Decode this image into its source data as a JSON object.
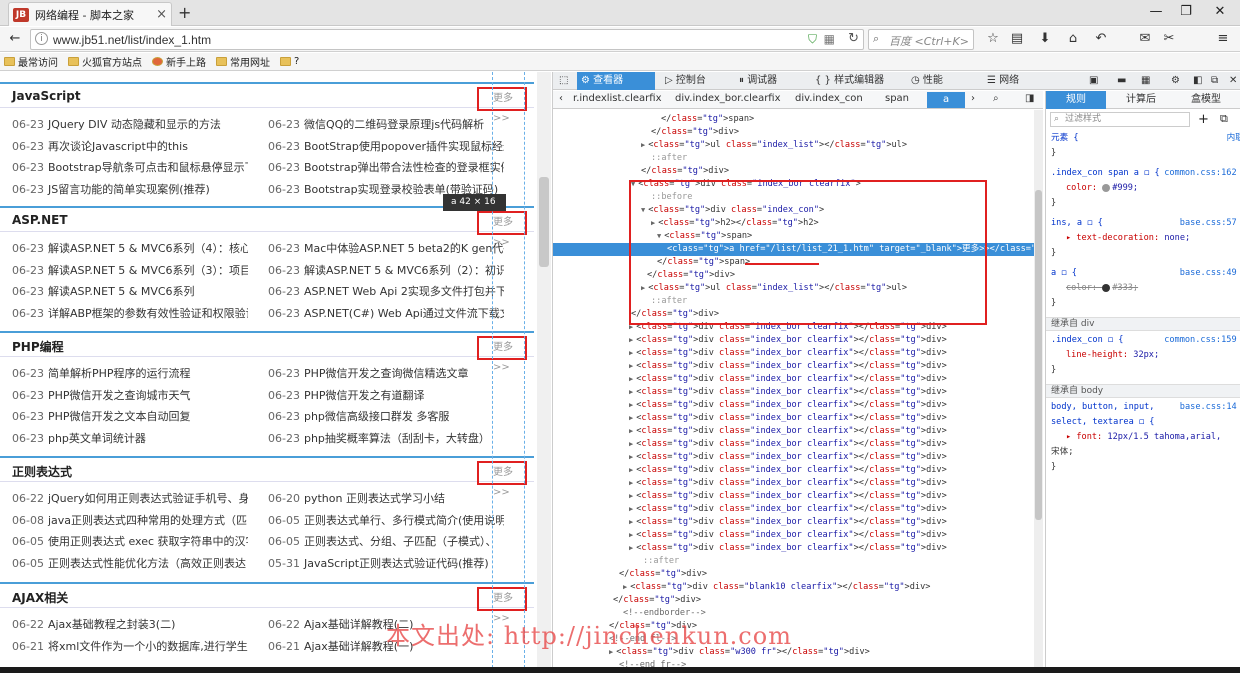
{
  "browser": {
    "tab_title": "网络编程 - 脚本之家",
    "favicon": "JB",
    "url": "www.jb51.net/list/index_1.htm",
    "search_placeholder": "百度 <Ctrl+K>",
    "bookmarks": [
      "最常访问",
      "火狐官方站点",
      "新手上路",
      "常用网址",
      "?"
    ]
  },
  "page": {
    "more_label": "更多>>",
    "tooltip": "a  42 × 16",
    "sections": [
      {
        "title": "JavaScript",
        "rows": [
          [
            "06-23",
            "JQuery DIV 动态隐藏和显示的方法"
          ],
          [
            "06-23",
            "微信QQ的二维码登录原理js代码解析"
          ],
          [
            "06-23",
            "再次谈论Javascript中的this"
          ],
          [
            "06-23",
            "BootStrap使用popover插件实现鼠标经过"
          ],
          [
            "06-23",
            "Bootstrap导航条可点击和鼠标悬停显示下"
          ],
          [
            "06-23",
            "Bootstrap弹出带合法性检查的登录框实例"
          ],
          [
            "06-23",
            "JS留言功能的简单实现案例(推荐)"
          ],
          [
            "06-23",
            "Bootstrap实现登录校验表单(带验证码)"
          ]
        ]
      },
      {
        "title": "ASP.NET",
        "rows": [
          [
            "06-23",
            "解读ASP.NET 5 & MVC6系列（4）：核心"
          ],
          [
            "06-23",
            "Mac中体验ASP.NET 5 beta2的K gen代码生"
          ],
          [
            "06-23",
            "解读ASP.NET 5 & MVC6系列（3）：项目"
          ],
          [
            "06-23",
            "解读ASP.NET 5 & MVC6系列（2）：初识"
          ],
          [
            "06-23",
            "解读ASP.NET 5 & MVC6系列"
          ],
          [
            "06-23",
            "ASP.NET Web Api 2实现多文件打包并下载"
          ],
          [
            "06-23",
            "详解ABP框架的参数有效性验证和权限验证"
          ],
          [
            "06-23",
            "ASP.NET(C#) Web Api通过文件流下载文件"
          ]
        ]
      },
      {
        "title": "PHP编程",
        "rows": [
          [
            "06-23",
            "简单解析PHP程序的运行流程"
          ],
          [
            "06-23",
            "PHP微信开发之查询微信精选文章"
          ],
          [
            "06-23",
            "PHP微信开发之查询城市天气"
          ],
          [
            "06-23",
            "PHP微信开发之有道翻译"
          ],
          [
            "06-23",
            "PHP微信开发之文本自动回复"
          ],
          [
            "06-23",
            "php微信高级接口群发 多客服"
          ],
          [
            "06-23",
            "php英文单词统计器"
          ],
          [
            "06-23",
            "php抽奖概率算法（刮刮卡，大转盘）"
          ]
        ]
      },
      {
        "title": "正则表达式",
        "rows": [
          [
            "06-22",
            "jQuery如何用正则表达式验证手机号、身"
          ],
          [
            "06-20",
            "python 正则表达式学习小结"
          ],
          [
            "06-08",
            "java正则表达式四种常用的处理方式（匹"
          ],
          [
            "06-05",
            "正则表达式单行、多行模式简介(使用说明)"
          ],
          [
            "06-05",
            "使用正则表达式 exec 获取字符串中的汉字"
          ],
          [
            "06-05",
            "正则表达式、分组、子匹配（子模式）、"
          ],
          [
            "06-05",
            "正则表达式性能优化方法（高效正则表达"
          ],
          [
            "05-31",
            "JavaScript正则表达式验证代码(推荐)"
          ]
        ]
      },
      {
        "title": "AJAX相关",
        "rows": [
          [
            "06-22",
            "Ajax基础教程之封装3(二)"
          ],
          [
            "06-22",
            "Ajax基础详解教程(二)"
          ],
          [
            "06-21",
            "将xml文件作为一个小的数据库,进行学生"
          ],
          [
            "06-21",
            "Ajax基础详解教程(一)"
          ]
        ]
      }
    ]
  },
  "devtools": {
    "tabs": [
      "查看器",
      "控制台",
      "调试器",
      "{ } 样式编辑器",
      "性能",
      "网络"
    ],
    "breadcrumbs": [
      "‹",
      "r.indexlist.clearfix",
      "div.index_bor.clearfix",
      "div.index_con",
      "span",
      "a",
      "›"
    ],
    "markup_lines": [
      "</span>",
      "</div>",
      "<ul class=\"index_list\"></ul>",
      "::after",
      "</div>",
      "<div class=\"index_bor clearfix\">",
      "::before",
      "<div class=\"index_con\">",
      "<h2></h2>",
      "<span>",
      "<a href=\"/list/list_21_1.htm\" target=\"_blank\">更多>></a>",
      "</span>",
      "</div>",
      "<ul class=\"index_list\"></ul>",
      "::after",
      "</div>",
      "<div class=\"index_bor clearfix\"></div>",
      "::after",
      "</div>",
      "<div class=\"blank10 clearfix\"></div>",
      "</div>",
      "<!--endborder-->",
      "</div>",
      "<!--end fl-->",
      "<div class=\"w300 fr\"></div>",
      "<!--end fr-->"
    ],
    "side_tabs": [
      "规则",
      "计算后",
      "盒模型"
    ],
    "filter_placeholder": "过滤样式",
    "rules": [
      {
        "t": "sel",
        "text": "元素 {",
        "src": "内联"
      },
      {
        "t": "plain",
        "text": "}"
      },
      {
        "t": "sel",
        "text": ".index_con span a ◻ {",
        "src": "common.css:162"
      },
      {
        "t": "decl",
        "prop": "color:",
        "val": "#999;",
        "swatch": "#999999"
      },
      {
        "t": "plain",
        "text": "}"
      },
      {
        "t": "sel",
        "text": "ins, a ◻ {",
        "src": "base.css:57"
      },
      {
        "t": "decl",
        "prop": "▸ text-decoration:",
        "val": "none;"
      },
      {
        "t": "plain",
        "text": "}"
      },
      {
        "t": "sel",
        "text": "a ◻ {",
        "src": "base.css:49"
      },
      {
        "t": "strike",
        "prop": "color:",
        "val": "#333;",
        "swatch": "#333333"
      },
      {
        "t": "plain",
        "text": "}"
      },
      {
        "t": "inh",
        "text": "继承自 div"
      },
      {
        "t": "sel",
        "text": ".index_con ◻ {",
        "src": "common.css:159"
      },
      {
        "t": "decl",
        "prop": "line-height:",
        "val": "32px;"
      },
      {
        "t": "plain",
        "text": "}"
      },
      {
        "t": "inh",
        "text": "继承自 body"
      },
      {
        "t": "sel",
        "text": "body, button, input,",
        "src": "base.css:14"
      },
      {
        "t": "sel",
        "text": "select, textarea ◻ {"
      },
      {
        "t": "decl",
        "prop": "▸ font:",
        "val": "12px/1.5 tahoma,arial,"
      },
      {
        "t": "plain",
        "text": "宋体;"
      },
      {
        "t": "plain",
        "text": "}"
      }
    ]
  },
  "watermark": "本文出处: http://jinchenkun.com",
  "colors": {
    "accent": "#3a8fd8",
    "highlight": "#e02020",
    "section_border": "#4a9ed8"
  }
}
